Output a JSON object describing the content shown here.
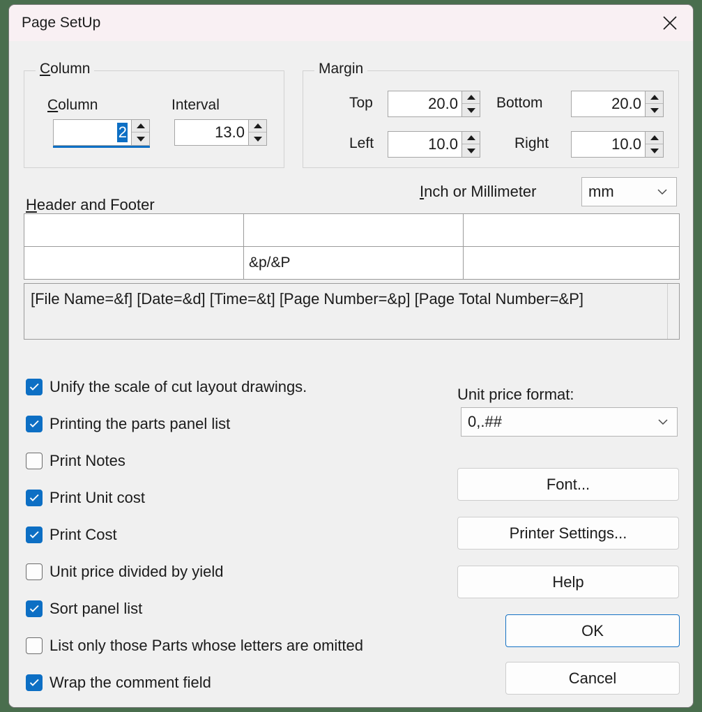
{
  "window": {
    "title": "Page SetUp",
    "close_icon": "close-icon"
  },
  "column_group": {
    "legend": "Column",
    "legend_accel": "C",
    "fields": [
      {
        "label": "Column",
        "label_accel": "C",
        "value": "2",
        "selected": true
      },
      {
        "label": "Interval",
        "label_accel": "",
        "value": "13.0",
        "selected": false
      }
    ]
  },
  "margin_group": {
    "legend": "Margin",
    "fields": [
      {
        "label": "Top",
        "value": "20.0"
      },
      {
        "label": "Bottom",
        "value": "20.0"
      },
      {
        "label": "Left",
        "value": "10.0"
      },
      {
        "label": "Right",
        "value": "10.0"
      }
    ]
  },
  "units": {
    "label": "Inch or Millimeter",
    "label_accel": "I",
    "value": "mm"
  },
  "header_footer": {
    "legend": "Header and Footer",
    "legend_accel": "H",
    "cells": [
      {
        "position": "header-left",
        "value": ""
      },
      {
        "position": "header-center",
        "value": ""
      },
      {
        "position": "header-right",
        "value": ""
      },
      {
        "position": "footer-left",
        "value": ""
      },
      {
        "position": "footer-center",
        "value": "&p/&P"
      },
      {
        "position": "footer-right",
        "value": ""
      }
    ],
    "help_text": "[File Name=&f] [Date=&d] [Time=&t] [Page Number=&p] [Page Total Number=&P]"
  },
  "options": [
    {
      "label": "Unify the scale of cut layout drawings.",
      "checked": true
    },
    {
      "label": "Printing the parts panel list",
      "checked": true
    },
    {
      "label": "Print Notes",
      "checked": false
    },
    {
      "label": "Print Unit cost",
      "checked": true
    },
    {
      "label": "Print Cost",
      "checked": true
    },
    {
      "label": "Unit price divided by yield",
      "checked": false
    },
    {
      "label": "Sort panel list",
      "checked": true
    },
    {
      "label": "List only those Parts whose letters are omitted",
      "checked": false
    },
    {
      "label": "Wrap the comment field",
      "checked": true
    }
  ],
  "unit_price": {
    "label": "Unit price format:",
    "value": "0,.##"
  },
  "buttons": {
    "font": "Font...",
    "printer_settings": "Printer Settings...",
    "help": "Help",
    "ok": "OK",
    "cancel": "Cancel"
  },
  "colors": {
    "titlebar": "#f9f0f3",
    "dialog_bg": "#f0f0f0",
    "accent": "#0d6fc4",
    "default_button_border": "#1572c4",
    "desktop": "#4a6e4e"
  }
}
